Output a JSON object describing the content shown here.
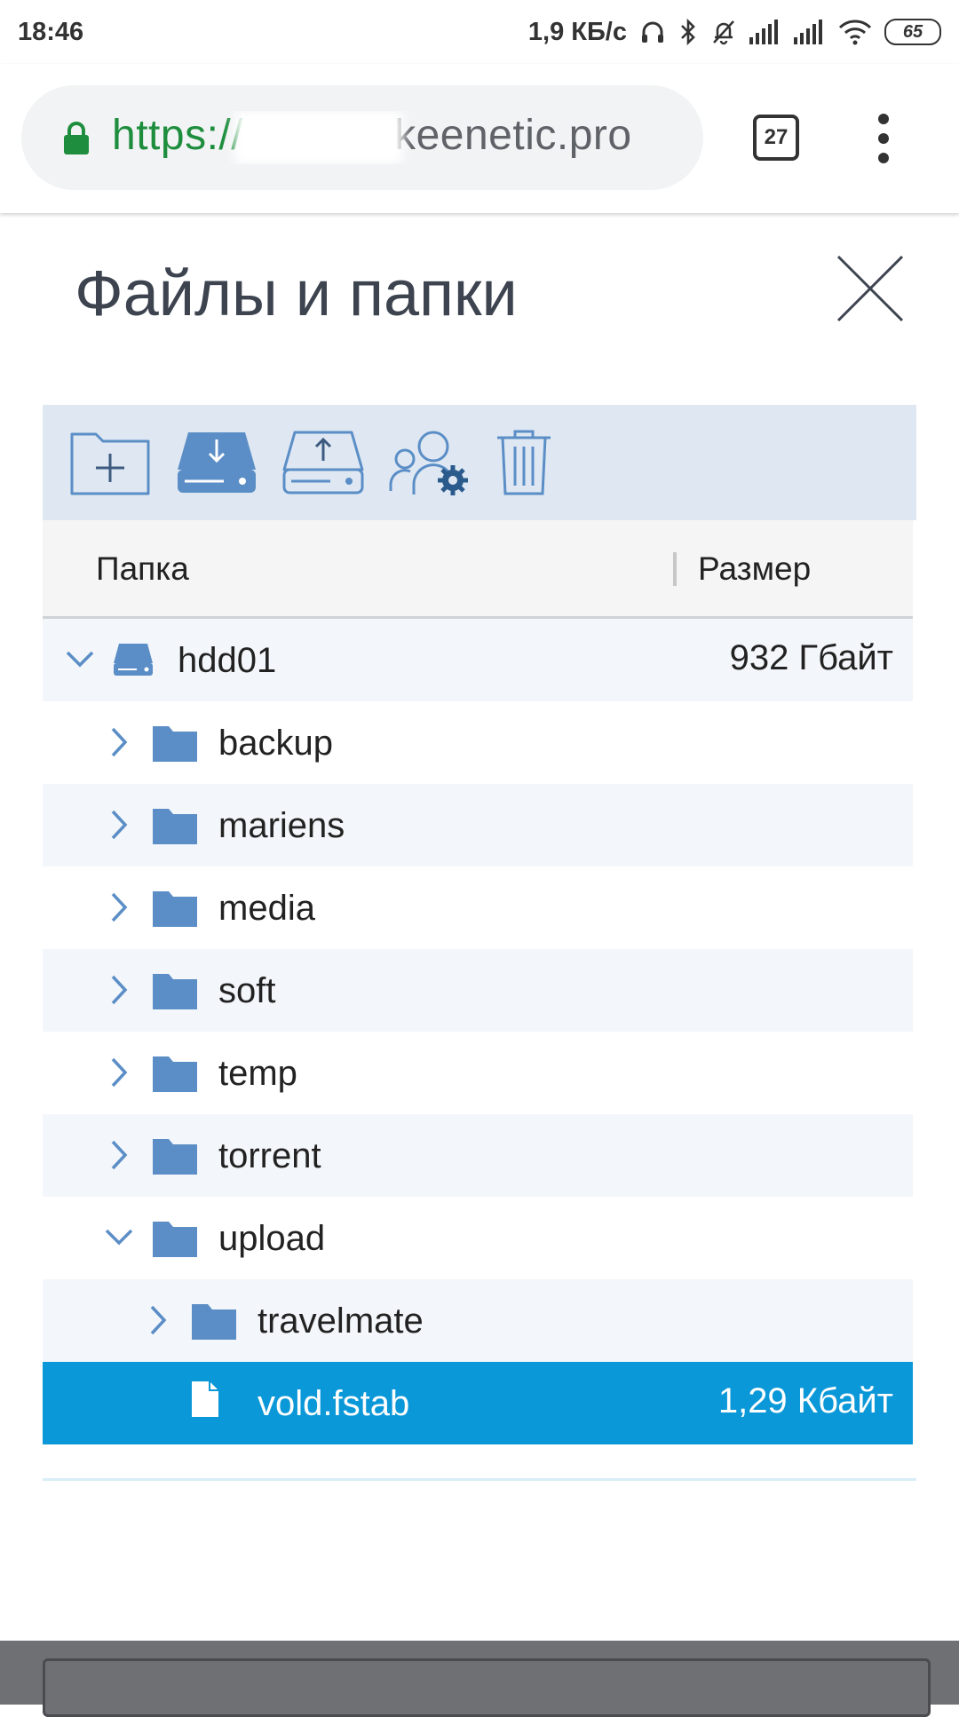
{
  "status_bar": {
    "time": "18:46",
    "net_speed": "1,9 КБ/с",
    "battery": "65"
  },
  "browser": {
    "url_scheme": "https://",
    "url_host": "keenetic.pro",
    "tab_count": "27"
  },
  "dialog": {
    "title": "Файлы и папки",
    "columns": {
      "folder": "Папка",
      "size": "Размер"
    },
    "rows": [
      {
        "name": "hdd01",
        "size": "932 Гбайт",
        "type": "drive",
        "expanded": true,
        "level": 0
      },
      {
        "name": "backup",
        "size": "",
        "type": "folder",
        "expanded": false,
        "level": 1
      },
      {
        "name": "mariens",
        "size": "",
        "type": "folder",
        "expanded": false,
        "level": 1
      },
      {
        "name": "media",
        "size": "",
        "type": "folder",
        "expanded": false,
        "level": 1
      },
      {
        "name": "soft",
        "size": "",
        "type": "folder",
        "expanded": false,
        "level": 1
      },
      {
        "name": "temp",
        "size": "",
        "type": "folder",
        "expanded": false,
        "level": 1
      },
      {
        "name": "torrent",
        "size": "",
        "type": "folder",
        "expanded": false,
        "level": 1
      },
      {
        "name": "upload",
        "size": "",
        "type": "folder",
        "expanded": true,
        "level": 1
      },
      {
        "name": "travelmate",
        "size": "",
        "type": "folder",
        "expanded": false,
        "level": 2
      },
      {
        "name": "vold.fstab",
        "size": "1,29 Кбайт",
        "type": "file",
        "selected": true,
        "level": 2
      }
    ]
  },
  "colors": {
    "accent": "#0b98d8",
    "icon_blue": "#5b8ec6",
    "toolbar_bg": "#dfe8f2"
  },
  "icons": [
    "lock-icon",
    "new-folder-icon",
    "download-icon",
    "upload-icon",
    "permissions-icon",
    "trash-icon",
    "close-icon",
    "chevron-right-icon",
    "chevron-down-icon",
    "folder-icon",
    "drive-icon",
    "file-icon"
  ]
}
